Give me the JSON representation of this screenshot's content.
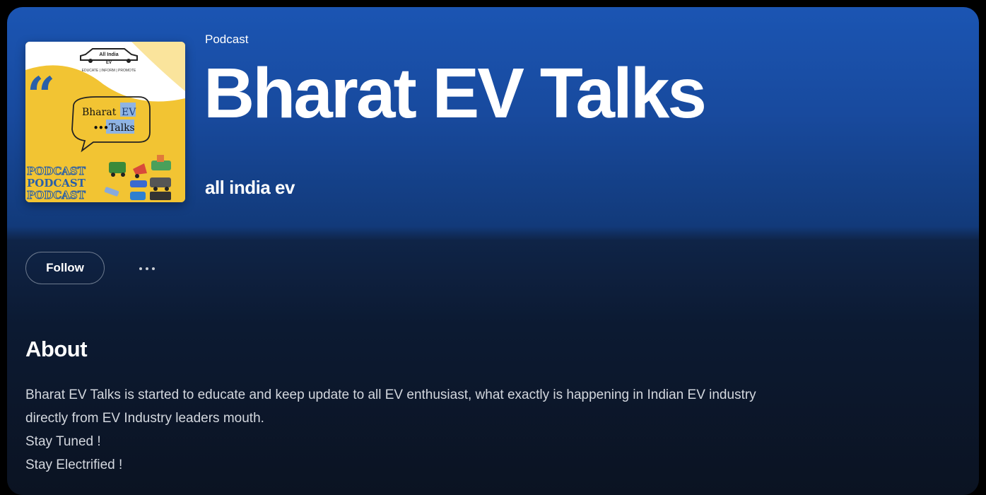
{
  "header": {
    "type_label": "Podcast",
    "title": "Bharat EV Talks",
    "author": "all india ev"
  },
  "cover_art": {
    "logo_top": "All India",
    "logo_bottom": "EV",
    "tagline": "EDUCATE | INFORM | PROMOTE",
    "bubble_word_1": "Bharat",
    "bubble_word_2": "EV",
    "bubble_word_3": "Talks",
    "podcast_text": "PODCAST",
    "background_color": "#f2c433",
    "quote_color": "#2a5fa8"
  },
  "actions": {
    "follow_label": "Follow",
    "more_icon": "more-horizontal-icon"
  },
  "about": {
    "heading": "About",
    "lines": [
      "Bharat EV Talks is started to educate and keep update to all EV enthusiast, what exactly is happening in Indian EV industry",
      "directly from EV Industry leaders mouth.",
      "Stay Tuned !",
      "Stay Electrified !"
    ]
  },
  "colors": {
    "header_gradient_top": "#1b55b3",
    "body_background": "#0b1322",
    "text_primary": "#ffffff",
    "text_secondary": "#d3d7de"
  }
}
